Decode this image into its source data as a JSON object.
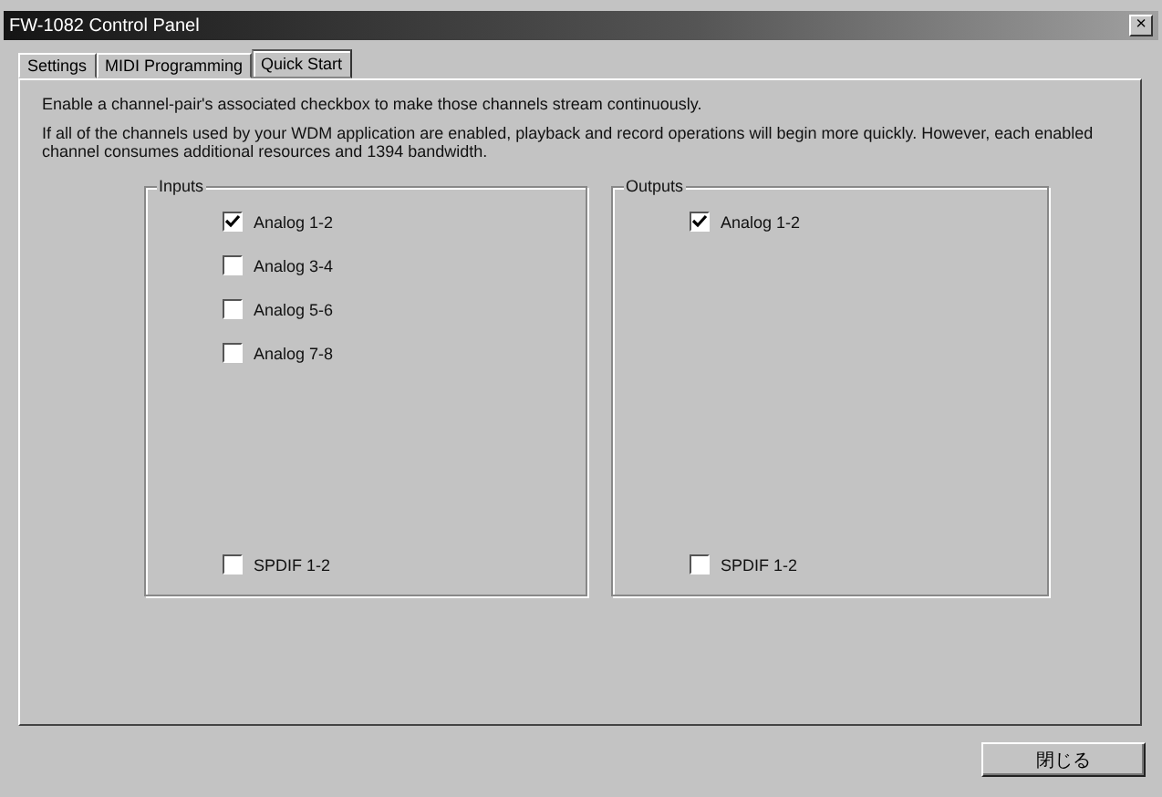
{
  "window": {
    "title": "FW-1082 Control Panel",
    "close": "×"
  },
  "tabs": [
    {
      "label": "Settings",
      "selected": false
    },
    {
      "label": "MIDI Programming",
      "selected": false
    },
    {
      "label": "Quick Start",
      "selected": true
    }
  ],
  "intro": "Enable a channel-pair's associated checkbox to make those channels stream continuously.",
  "note": "If all of the channels used by your WDM application are enabled, playback and record operations will begin more quickly. However, each enabled channel consumes additional resources and 1394 bandwidth.",
  "groups": [
    {
      "label": "Inputs",
      "items": [
        {
          "label": "Analog 1-2",
          "checked": true
        },
        {
          "label": "Analog 3-4",
          "checked": false
        },
        {
          "label": "Analog 5-6",
          "checked": false
        },
        {
          "label": "Analog 7-8",
          "checked": false
        }
      ],
      "spdif": {
        "label": "SPDIF 1-2",
        "checked": false
      }
    },
    {
      "label": "Outputs",
      "items": [
        {
          "label": "Analog 1-2",
          "checked": true
        }
      ],
      "spdif": {
        "label": "SPDIF 1-2",
        "checked": false
      }
    }
  ],
  "button": "閉じる"
}
